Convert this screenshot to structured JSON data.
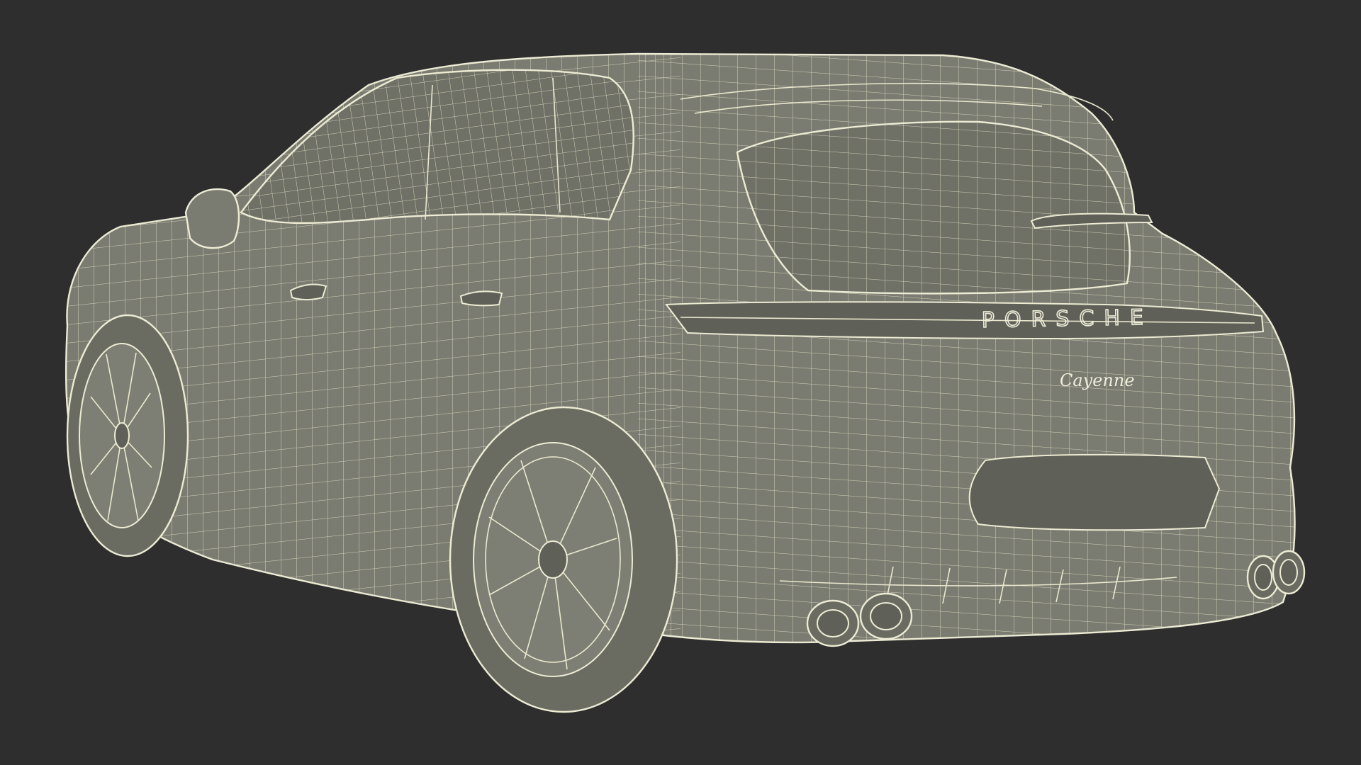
{
  "badges": {
    "brand": "PORSCHE",
    "model": "Cayenne"
  },
  "colors": {
    "background": "#2e2e2e",
    "surface": "#7b7c71",
    "wire": "#ecebd4"
  }
}
